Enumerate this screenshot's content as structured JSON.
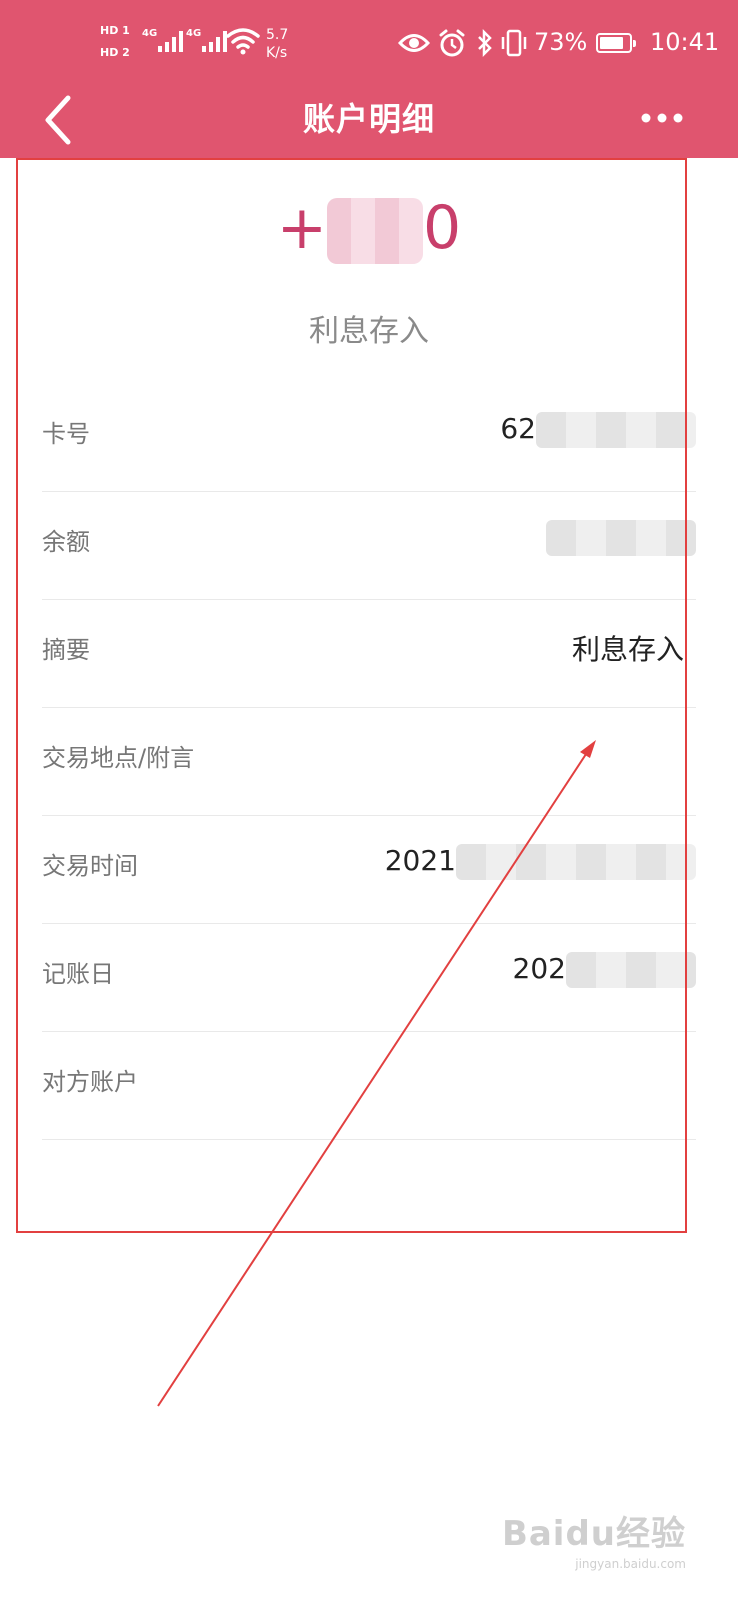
{
  "status_bar": {
    "hd1": "HD 1",
    "hd2": "HD 2",
    "signal1_label": "4G",
    "signal2_label": "4G",
    "net_speed_value": "5.7",
    "net_speed_unit": "K/s",
    "battery_percent": "73%",
    "battery_level": 0.73,
    "time": "10:41",
    "icons": [
      "eye-icon",
      "alarm-icon",
      "bluetooth-icon",
      "vibrate-icon",
      "battery-icon"
    ]
  },
  "nav": {
    "title": "账户明细",
    "back_icon": "chevron-left-icon",
    "more_icon": "more-horizontal-icon"
  },
  "transaction": {
    "amount_prefix": "+",
    "amount_suffix": "0",
    "type": "利息存入"
  },
  "details": [
    {
      "label": "卡号",
      "value": "62"
    },
    {
      "label": "余额",
      "value": ""
    },
    {
      "label": "摘要",
      "value": "利息存入"
    },
    {
      "label": "交易地点/附言",
      "value": ""
    },
    {
      "label": "交易时间",
      "value": "2021"
    },
    {
      "label": "记账日",
      "value": "202"
    },
    {
      "label": "对方账户",
      "value": ""
    }
  ],
  "watermark": {
    "brand": "Baidu经验",
    "url": "jingyan.baidu.com"
  },
  "colors": {
    "header": "#e0556f",
    "amount": "#c83f6b",
    "annotation": "#e24040"
  }
}
